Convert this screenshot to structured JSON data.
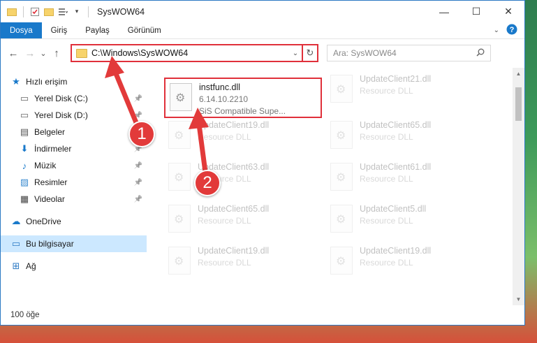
{
  "window": {
    "title": "SysWOW64",
    "controls": {
      "minimize": "—",
      "maximize": "☐",
      "close": "✕"
    }
  },
  "ribbon": {
    "tabs": [
      "Dosya",
      "Giriş",
      "Paylaş",
      "Görünüm"
    ],
    "active_tab": "Dosya"
  },
  "nav": {
    "back": "←",
    "forward": "→",
    "recent": "⌄",
    "up": "↑",
    "address": "C:\\Windows\\SysWOW64",
    "search_placeholder": "Ara: SysWOW64"
  },
  "sidebar": {
    "items": [
      {
        "label": "Hızlı erişim",
        "icon": "star-icon",
        "glyph": "★",
        "color": "#1979ca",
        "pinned": false,
        "top": true
      },
      {
        "label": "Yerel Disk (C:)",
        "icon": "drive-icon",
        "glyph": "▭",
        "color": "#666",
        "pinned": true,
        "top": false
      },
      {
        "label": "Yerel Disk (D:)",
        "icon": "drive-icon",
        "glyph": "▭",
        "color": "#666",
        "pinned": true,
        "top": false
      },
      {
        "label": "Belgeler",
        "icon": "documents-icon",
        "glyph": "▤",
        "color": "#555",
        "pinned": true,
        "top": false
      },
      {
        "label": "İndirmeler",
        "icon": "download-icon",
        "glyph": "⬇",
        "color": "#1979ca",
        "pinned": true,
        "top": false
      },
      {
        "label": "Müzik",
        "icon": "music-icon",
        "glyph": "♪",
        "color": "#1979ca",
        "pinned": true,
        "top": false
      },
      {
        "label": "Resimler",
        "icon": "pictures-icon",
        "glyph": "▨",
        "color": "#3a8bd0",
        "pinned": true,
        "top": false
      },
      {
        "label": "Videolar",
        "icon": "videos-icon",
        "glyph": "▦",
        "color": "#444",
        "pinned": true,
        "top": false
      },
      {
        "label": "OneDrive",
        "icon": "cloud-icon",
        "glyph": "☁",
        "color": "#1979ca",
        "pinned": false,
        "top": true
      },
      {
        "label": "Bu bilgisayar",
        "icon": "computer-icon",
        "glyph": "▭",
        "color": "#2b79c4",
        "pinned": false,
        "top": true,
        "selected": true
      },
      {
        "label": "Ağ",
        "icon": "network-icon",
        "glyph": "⊞",
        "color": "#2b79c4",
        "pinned": false,
        "top": true
      }
    ]
  },
  "files": {
    "highlighted": {
      "name": "instfunc.dll",
      "version": "6.14.10.2210",
      "description": "SiS Compatible Supe..."
    },
    "faded": [
      {
        "name": "UpdateClient21.dll",
        "sub": "Resource DLL"
      },
      {
        "name": "UpdateClient19.dll",
        "sub": "Resource DLL"
      },
      {
        "name": "UpdateClient65.dll",
        "sub": "Resource DLL"
      },
      {
        "name": "UpdateClient63.dll",
        "sub": "Resource DLL"
      },
      {
        "name": "UpdateClient61.dll",
        "sub": "Resource DLL"
      },
      {
        "name": "UpdateClient65.dll",
        "sub": "Resource DLL"
      },
      {
        "name": "UpdateClient5.dll",
        "sub": "Resource DLL"
      },
      {
        "name": "UpdateClient19.dll",
        "sub": "Resource DLL"
      },
      {
        "name": "UpdateClient19.dll",
        "sub": "Resource DLL"
      }
    ]
  },
  "status": {
    "count": "100 öğe"
  },
  "annotations": {
    "step1": "1",
    "step2": "2",
    "color": "#e23a3a"
  }
}
